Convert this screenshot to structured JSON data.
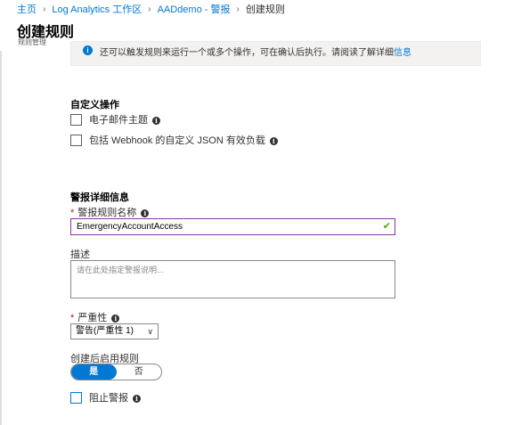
{
  "breadcrumb": {
    "items": [
      "主页",
      "Log Analytics 工作区",
      "AADdemo - 警报"
    ],
    "current": "创建规则",
    "separator": "›"
  },
  "header": {
    "title": "创建规则",
    "subtitle": "规则管理"
  },
  "info_bar": {
    "text": "还可以触发规则来运行一个或多个操作，可在确认后执行。请阅读了解详细",
    "link": "信息"
  },
  "custom_actions": {
    "heading": "自定义操作",
    "email_subject_label": "电子邮件主题",
    "webhook_label": "包括 Webhook 的自定义 JSON 有效负载"
  },
  "alert_details": {
    "heading": "警报详细信息",
    "name_label": "警报规则名称",
    "name_value": "EmergencyAccountAccess",
    "description_label": "描述",
    "description_placeholder": "请在此处指定警报说明...",
    "severity_label": "严重性",
    "severity_value": "警告(严重性 1)",
    "enable_label": "创建后启用规则",
    "enable_yes": "是",
    "enable_no": "否",
    "enable_selected": "是",
    "suppress_label": "阻止警报"
  },
  "colors": {
    "accent": "#0078d4",
    "required": "#a4262c",
    "valid": "#57a300",
    "focus_border": "#8a37a8"
  },
  "icons": {
    "info": "info-circle-icon",
    "valid": "checkmark-icon",
    "dropdown": "chevron-down-icon",
    "breadcrumb_separator": "chevron-right-icon"
  }
}
